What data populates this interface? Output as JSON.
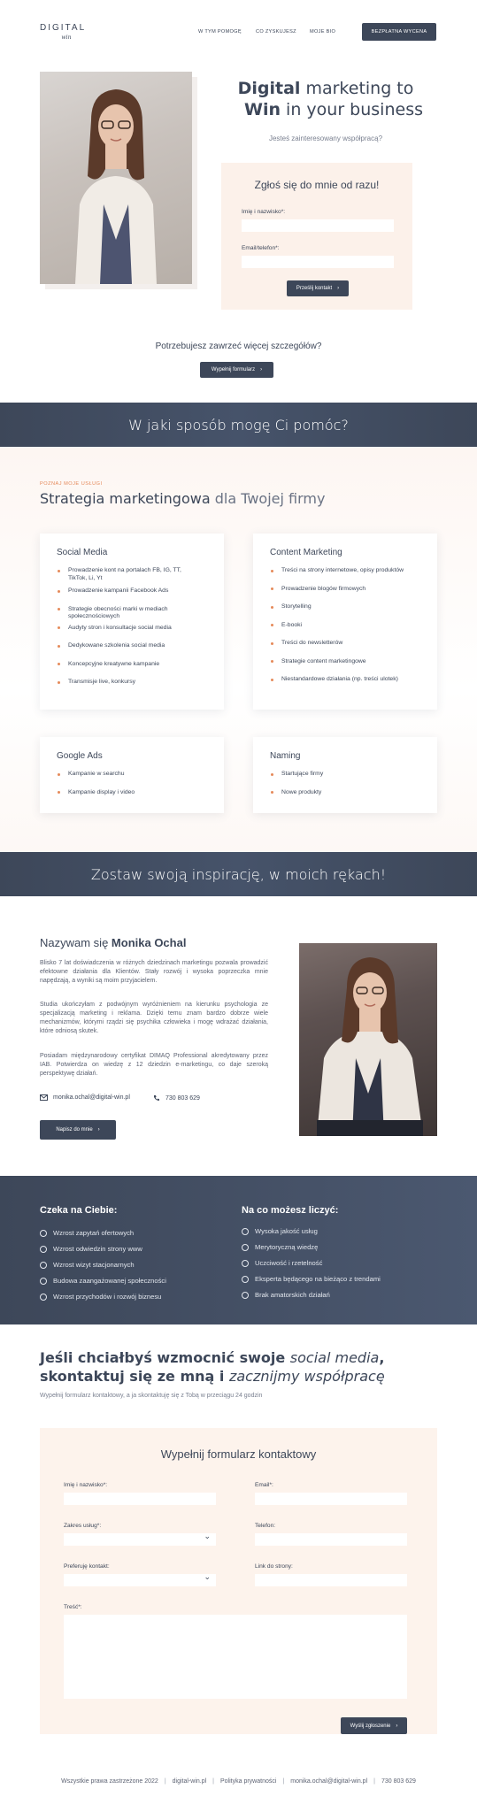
{
  "header": {
    "logo_line1": "DIGITAL",
    "logo_line2": "win",
    "nav": [
      "W TYM POMOGĘ",
      "CO ZYSKUJESZ",
      "MOJE BIO"
    ],
    "cta": "BEZPŁATNA WYCENA"
  },
  "hero": {
    "title_l1_bold": "Digital",
    "title_l1_rest": " marketing to",
    "title_l2_bold": "Win",
    "title_l2_rest": " in your business",
    "subtitle": "Jesteś zainteresowany współpracą?",
    "form": {
      "title": "Zgłoś się do mnie od razu!",
      "name_label": "Imię i nazwisko*:",
      "email_label": "Email/telefon*:",
      "submit": "Prześlij kontakt"
    },
    "more_question": "Potrzebujesz zawrzeć więcej szczegółów?",
    "more_button": "Wypełnij formularz"
  },
  "help_band": "W jaki sposób mogę Ci pomóc?",
  "services": {
    "kicker": "POZNAJ MOJE USŁUGI",
    "title_bold": "Strategia marketingowa",
    "title_rest": " dla Twojej firmy",
    "cards": [
      {
        "title": "Social Media",
        "items": [
          "Prowadzenie kont na portalach FB, IG, TT, TikTok, Li, Yt",
          "Prowadzenie kampanii Facebook Ads",
          "Strategie obecności marki w mediach społecznościowych",
          "Audyty stron i konsultacje social media",
          "Dedykowane szkolenia social media",
          "Koncepcyjne kreatywne kampanie",
          "Transmisje live, konkursy"
        ]
      },
      {
        "title": "Content Marketing",
        "items": [
          "Treści na strony internetowe, opisy produktów",
          "Prowadzenie blogów firmowych",
          "Storytelling",
          "E-booki",
          "Treści do newsletterów",
          "Strategie content marketingowe",
          "Niestandardowe działania (np. treści ulotek)"
        ]
      },
      {
        "title": "Google Ads",
        "items": [
          "Kampanie w searchu",
          "Kampanie display i video"
        ]
      },
      {
        "title": "Naming",
        "items": [
          "Startujące firmy",
          "Nowe produkty"
        ]
      }
    ]
  },
  "inspire_band": "Zostaw swoją inspirację, w moich rękach!",
  "about": {
    "name_prefix": "Nazywam się ",
    "name": "Monika Ochal",
    "p1": "Blisko 7 lat doświadczenia w różnych dziedzinach marketingu pozwala prowadzić efektowne działania dla Klientów. Stały rozwój i wysoka poprzeczka mnie napędzają, a wyniki są moim przyjacielem.",
    "p2": "Studia ukończyłam z podwójnym wyróżnieniem na kierunku psychologia ze specjalizacją marketing i reklama. Dzięki temu znam bardzo dobrze wiele mechanizmów, którymi rządzi się psychika człowieka i mogę wdrażać działania, które odniosą skutek.",
    "p3": "Posiadam międzynarodowy certyfikat DIMAQ Professional akredytowany przez IAB. Potwierdza on wiedzę z 12 dziedzin e-marketingu, co daje szeroką perspektywę działań.",
    "email": "monika.ochal@digital-win.pl",
    "phone": "730 803 629",
    "button": "Napisz do mnie"
  },
  "benefits": {
    "left_title": "Czeka na Ciebie:",
    "left_items": [
      "Wzrost zapytań ofertowych",
      "Wzrost odwiedzin strony www",
      "Wzrost wizyt stacjonarnych",
      "Budowa zaangażowanej społeczności",
      "Wzrost przychodów i rozwój biznesu"
    ],
    "right_title": "Na co możesz liczyć:",
    "right_items": [
      "Wysoka jakość usług",
      "Merytoryczną wiedzę",
      "Uczciwość i rzetelność",
      "Eksperta będącego na bieżąco z trendami",
      "Brak amatorskich działań"
    ]
  },
  "contact": {
    "h_l1_a": "Jeśli chciałbyś wzmocnić swoje ",
    "h_l1_i": "social media",
    "h_l1_b": ",",
    "h_l2_a": "skontaktuj się ze mną i ",
    "h_l2_i": "zacznijmy współpracę",
    "sub": "Wypełnij formularz kontaktowy, a ja skontaktuję się z Tobą w przeciągu 24 godzin",
    "form_title": "Wypełnij formularz kontaktowy",
    "labels": {
      "name": "Imię i nazwisko*:",
      "email": "Email*:",
      "scope": "Zakres usług*:",
      "phone": "Telefon:",
      "pref": "Preferuję kontakt:",
      "link": "Link do strony:",
      "message": "Treść*:"
    },
    "submit": "Wyślij zgłoszenie"
  },
  "footer": {
    "rights": "Wszystkie prawa zastrzeżone 2022",
    "site": "digital-win.pl",
    "privacy": "Polityka prywatności",
    "email": "monika.ochal@digital-win.pl",
    "phone": "730 803 629"
  },
  "colors": {
    "navy": "#3d4759",
    "accent": "#e58a5a",
    "peach": "#fcf1ea"
  }
}
